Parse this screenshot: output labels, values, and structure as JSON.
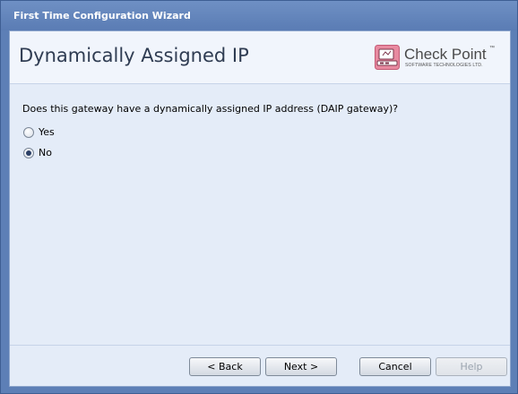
{
  "window": {
    "title": "First Time Configuration Wizard"
  },
  "header": {
    "page_title": "Dynamically Assigned IP",
    "logo": {
      "name": "Check Point",
      "trademark": "™",
      "tagline": "SOFTWARE TECHNOLOGIES LTD."
    }
  },
  "main": {
    "question": "Does this gateway have a dynamically assigned IP address (DAIP gateway)?",
    "options": [
      {
        "label": "Yes",
        "checked": false
      },
      {
        "label": "No",
        "checked": true
      }
    ]
  },
  "footer": {
    "back_label": "< Back",
    "next_label": "Next >",
    "cancel_label": "Cancel",
    "help_label": "Help",
    "help_enabled": false
  },
  "colors": {
    "window_frame": "#5d7fb6",
    "content_bg": "#e4ecf8",
    "header_bg": "#f1f5fc",
    "logo_accent": "#e88aa0"
  }
}
